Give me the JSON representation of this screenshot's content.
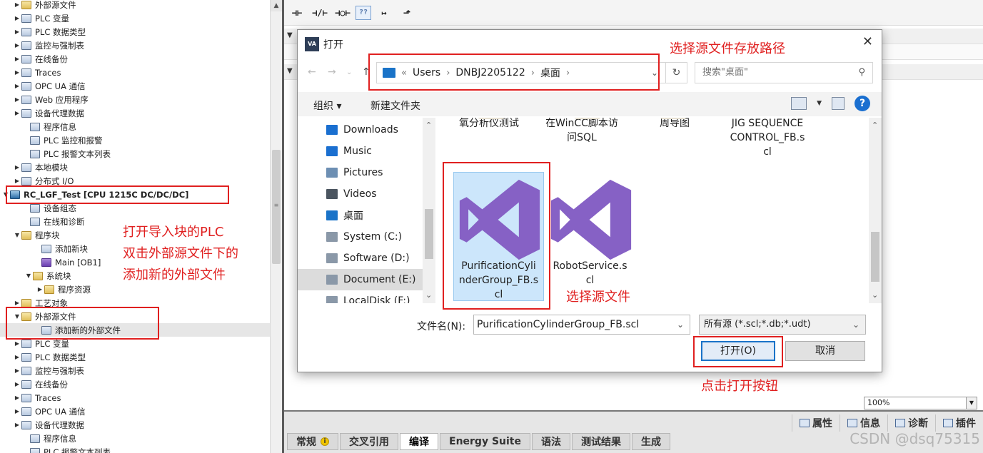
{
  "tree": {
    "items": [
      {
        "label": "外部源文件",
        "arrow": "▶",
        "icon": "folder",
        "indent": 18
      },
      {
        "label": "PLC 变量",
        "arrow": "▶",
        "icon": "doc",
        "indent": 18
      },
      {
        "label": "PLC 数据类型",
        "arrow": "▶",
        "icon": "doc",
        "indent": 18
      },
      {
        "label": "监控与强制表",
        "arrow": "▶",
        "icon": "doc",
        "indent": 18
      },
      {
        "label": "在线备份",
        "arrow": "▶",
        "icon": "doc",
        "indent": 18
      },
      {
        "label": "Traces",
        "arrow": "▶",
        "icon": "doc",
        "indent": 18
      },
      {
        "label": "OPC UA 通信",
        "arrow": "▶",
        "icon": "doc",
        "indent": 18
      },
      {
        "label": "Web 应用程序",
        "arrow": "▶",
        "icon": "doc",
        "indent": 18
      },
      {
        "label": "设备代理数据",
        "arrow": "▶",
        "icon": "doc",
        "indent": 18
      },
      {
        "label": "程序信息",
        "arrow": "",
        "icon": "doc",
        "indent": 30
      },
      {
        "label": "PLC 监控和报警",
        "arrow": "",
        "icon": "doc",
        "indent": 30
      },
      {
        "label": "PLC 报警文本列表",
        "arrow": "",
        "icon": "doc",
        "indent": 30
      },
      {
        "label": "本地模块",
        "arrow": "▶",
        "icon": "doc",
        "indent": 18
      },
      {
        "label": "分布式 I/O",
        "arrow": "▶",
        "icon": "doc",
        "indent": 18
      },
      {
        "label": "RC_LGF_Test [CPU 1215C DC/DC/DC]",
        "arrow": "▼",
        "icon": "cpu",
        "indent": 2,
        "bold": true
      },
      {
        "label": "设备组态",
        "arrow": "",
        "icon": "doc",
        "indent": 30
      },
      {
        "label": "在线和诊断",
        "arrow": "",
        "icon": "doc",
        "indent": 30
      },
      {
        "label": "程序块",
        "arrow": "▼",
        "icon": "folder",
        "indent": 18
      },
      {
        "label": "添加新块",
        "arrow": "",
        "icon": "doc",
        "indent": 46
      },
      {
        "label": "Main [OB1]",
        "arrow": "",
        "icon": "block",
        "indent": 46
      },
      {
        "label": "系统块",
        "arrow": "▼",
        "icon": "folder",
        "indent": 34
      },
      {
        "label": "程序资源",
        "arrow": "▶",
        "icon": "folder",
        "indent": 50
      },
      {
        "label": "工艺对象",
        "arrow": "▶",
        "icon": "folder",
        "indent": 18
      },
      {
        "label": "外部源文件",
        "arrow": "▼",
        "icon": "folder",
        "indent": 18
      },
      {
        "label": "添加新的外部文件",
        "arrow": "",
        "icon": "doc",
        "indent": 46,
        "selected": true
      },
      {
        "label": "PLC 变量",
        "arrow": "▶",
        "icon": "doc",
        "indent": 18
      },
      {
        "label": "PLC 数据类型",
        "arrow": "▶",
        "icon": "doc",
        "indent": 18
      },
      {
        "label": "监控与强制表",
        "arrow": "▶",
        "icon": "doc",
        "indent": 18
      },
      {
        "label": "在线备份",
        "arrow": "▶",
        "icon": "doc",
        "indent": 18
      },
      {
        "label": "Traces",
        "arrow": "▶",
        "icon": "doc",
        "indent": 18
      },
      {
        "label": "OPC UA 通信",
        "arrow": "▶",
        "icon": "doc",
        "indent": 18
      },
      {
        "label": "设备代理数据",
        "arrow": "▶",
        "icon": "doc",
        "indent": 18
      },
      {
        "label": "程序信息",
        "arrow": "",
        "icon": "doc",
        "indent": 30
      },
      {
        "label": "PLC 报警文本列表",
        "arrow": "",
        "icon": "doc",
        "indent": 30
      }
    ]
  },
  "ladder_toolbar": {
    "buttons": [
      "⊣⊢",
      "⊣/⊢",
      "⊣○⊢",
      "??",
      "↦",
      "⬏"
    ]
  },
  "editor": {
    "zoom": "100%"
  },
  "inspector": {
    "tabs": [
      {
        "label": "属性",
        "icon": "properties-icon"
      },
      {
        "label": "信息",
        "icon": "info-icon"
      },
      {
        "label": "诊断",
        "icon": "diagnostics-icon"
      },
      {
        "label": "插件",
        "icon": "plugin-icon"
      }
    ],
    "sub_tabs": [
      {
        "label": "常规"
      },
      {
        "label": "交叉引用"
      },
      {
        "label": "编译",
        "active": true
      },
      {
        "label": "Energy Suite"
      },
      {
        "label": "语法"
      },
      {
        "label": "测试结果"
      },
      {
        "label": "生成"
      }
    ]
  },
  "dialog": {
    "title": "打开",
    "logo_text": "VA",
    "close": "✕",
    "breadcrumb": [
      "Users",
      "DNBJ2205122",
      "桌面"
    ],
    "search_placeholder": "搜索\"桌面\"",
    "commands": {
      "organize": "组织 ▾",
      "new_folder": "新建文件夹"
    },
    "nav_items": [
      {
        "label": "Downloads",
        "icon": "downloads-icon",
        "color": "#1a6fd0"
      },
      {
        "label": "Music",
        "icon": "music-icon",
        "color": "#1a6fd0"
      },
      {
        "label": "Pictures",
        "icon": "pictures-icon",
        "color": "#6d8fb3"
      },
      {
        "label": "Videos",
        "icon": "videos-icon",
        "color": "#4b5560"
      },
      {
        "label": "桌面",
        "icon": "desktop-icon",
        "color": "#1a73c8"
      },
      {
        "label": "System (C:)",
        "icon": "drive-c-icon",
        "color": "#8a98a8"
      },
      {
        "label": "Software (D:)",
        "icon": "drive-d-icon",
        "color": "#8a98a8"
      },
      {
        "label": "Document (E:)",
        "icon": "drive-e-icon",
        "color": "#8a98a8",
        "selected": true
      },
      {
        "label": "LocalDisk (F:)",
        "icon": "drive-f-icon",
        "color": "#8a98a8"
      }
    ],
    "files_top": [
      {
        "label": "氧分析仪测试"
      },
      {
        "label": "在WinCC脚本访\n问SQL"
      },
      {
        "label": "周导图"
      },
      {
        "label": "JIG SEQUENCE\nCONTROL_FB.s\ncl"
      }
    ],
    "files": [
      {
        "label": "PurificationCyli\nnderGroup_FB.s\ncl",
        "selected": true
      },
      {
        "label": "RobotService.s\ncl"
      }
    ],
    "filename_label": "文件名(N):",
    "filename_value": "PurificationCylinderGroup_FB.scl",
    "filetype_value": "所有源 (*.scl;*.db;*.udt)",
    "open_button": "打开(O)",
    "cancel_button": "取消",
    "vs_color": "#8661c5"
  },
  "annotations": {
    "path_note": "选择源文件存放路径",
    "plc_note": [
      "打开导入块的PLC",
      "双击外部源文件下的",
      "添加新的外部文件"
    ],
    "file_note": "选择源文件",
    "open_note": "点击打开按钮",
    "color": "#e02020"
  },
  "watermark": "CSDN @dsq75315"
}
